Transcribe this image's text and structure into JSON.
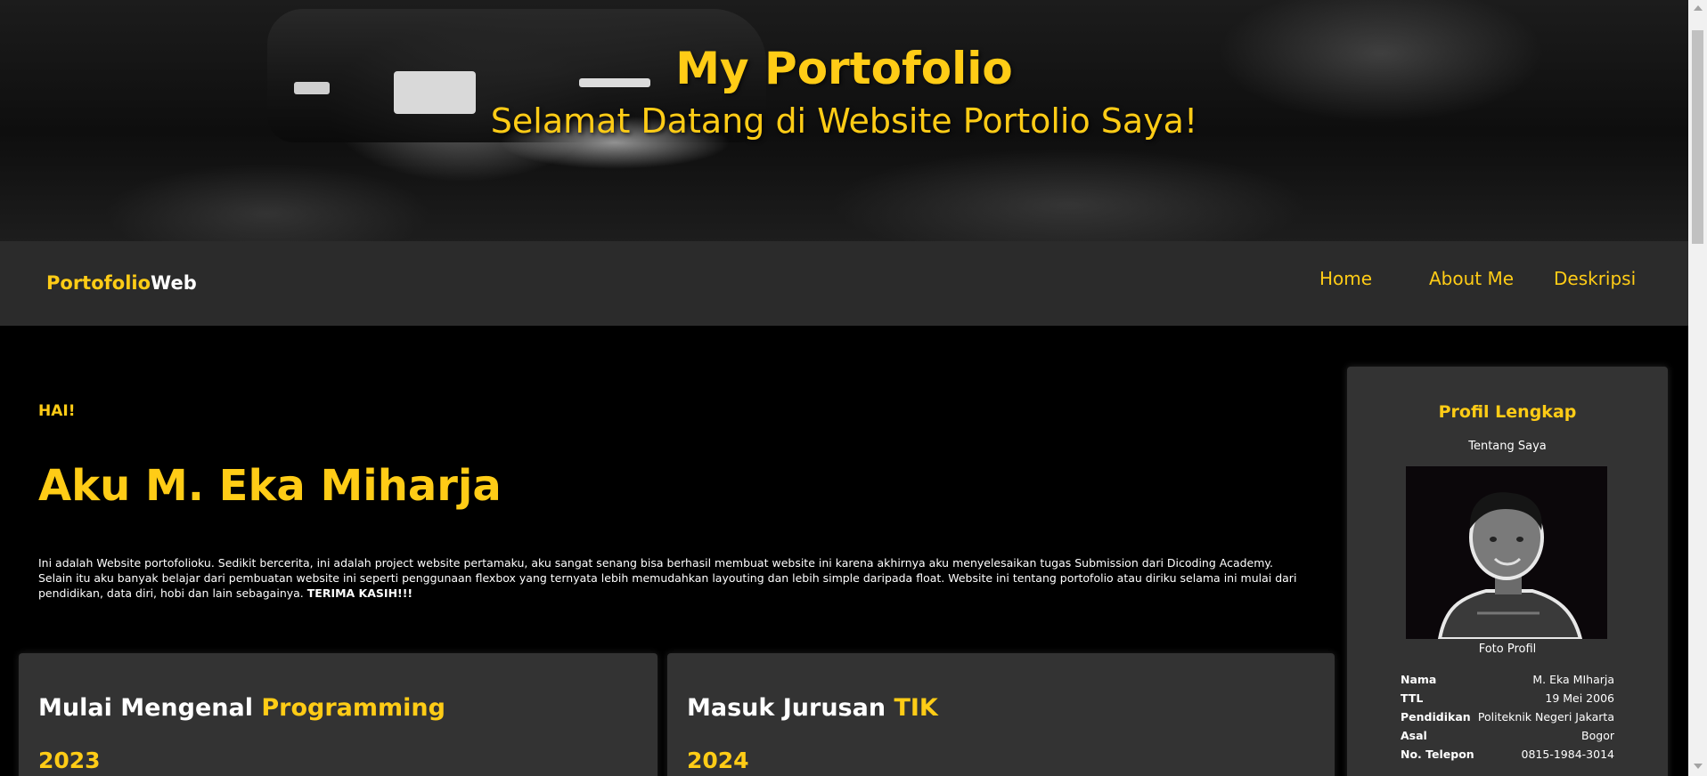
{
  "hero": {
    "title": "My Portofolio",
    "subtitle": "Selamat Datang di Website Portolio Saya!"
  },
  "navbar": {
    "brand_part1": "Portofolio",
    "brand_part2": "Web",
    "links": [
      "Home",
      "About Me",
      "Deskripsi"
    ]
  },
  "main": {
    "greeting": "HAI!",
    "name": "Aku M. Eka Miharja",
    "intro_text": "Ini adalah Website portofolioku. Sedikit bercerita, ini adalah project website pertamaku, aku sangat senang bisa berhasil membuat website ini karena akhirnya aku menyelesaikan tugas Submission dari Dicoding Academy. Selain itu aku banyak belajar dari pembuatan website ini seperti penggunaan flexbox yang ternyata lebih memudahkan layouting dan lebih simple daripada float. Website ini tentang portofolio atau diriku selama ini mulai dari pendidikan, data diri, hobi dan lain sebagainya. ",
    "intro_bold": "TERIMA KASIH!!!",
    "cards": [
      {
        "title_plain": "Mulai Mengenal ",
        "title_highlight": "Programming",
        "year": "2023"
      },
      {
        "title_plain": "Masuk Jurusan ",
        "title_highlight": "TIK",
        "year": "2024"
      }
    ]
  },
  "profile": {
    "title": "Profil Lengkap",
    "subtitle": "Tentang Saya",
    "photo_caption": "Foto Profil",
    "rows": [
      {
        "label": "Nama",
        "value": "M. Eka MIharja"
      },
      {
        "label": "TTL",
        "value": "19 Mei 2006"
      },
      {
        "label": "Pendidikan",
        "value": "Politeknik Negeri Jakarta"
      },
      {
        "label": "Asal",
        "value": "Bogor"
      },
      {
        "label": "No. Telepon",
        "value": "0815-1984-3014"
      }
    ]
  },
  "colors": {
    "accent": "#ffcc16",
    "navbar_bg": "#2b2b2b",
    "card_bg": "#333333",
    "page_bg": "#000000"
  }
}
